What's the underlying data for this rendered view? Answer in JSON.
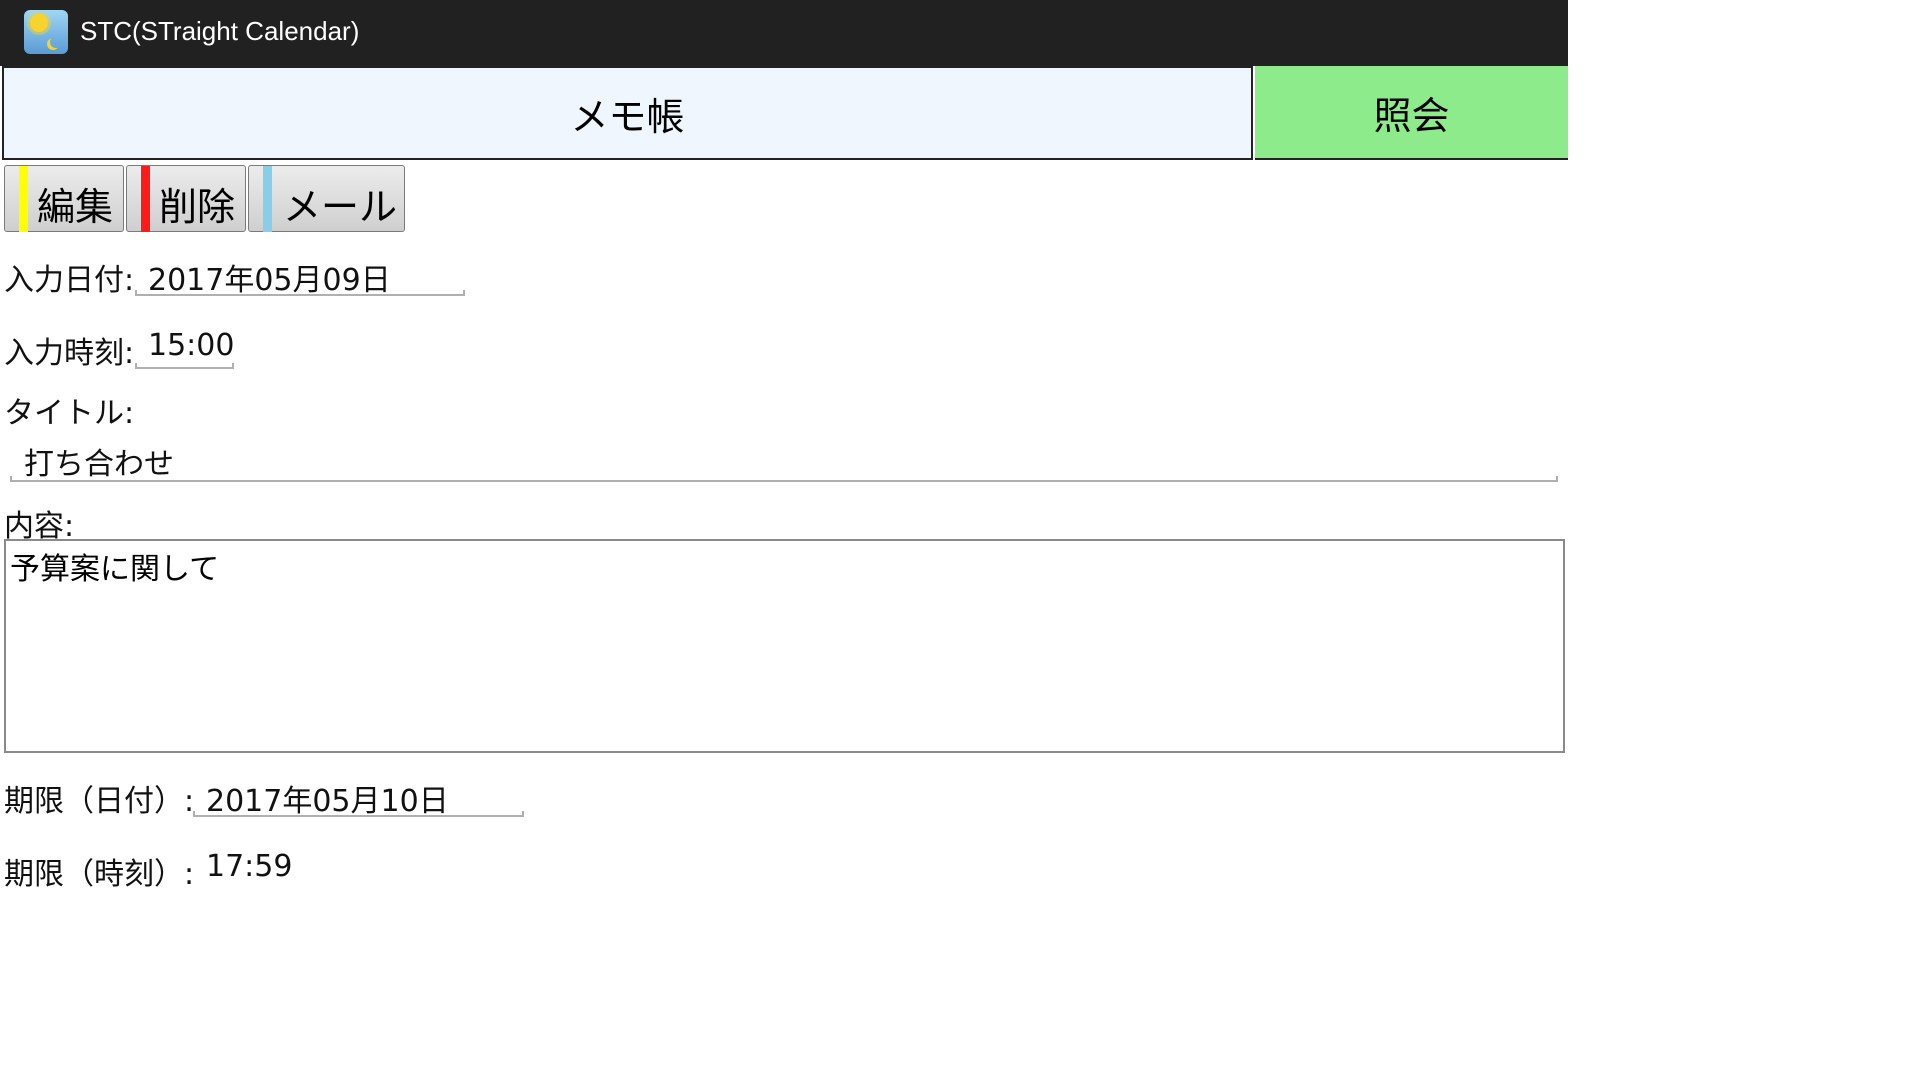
{
  "app": {
    "title": "STC(STraight Calendar)",
    "icon": "app-icon"
  },
  "header": {
    "memo_label": "メモ帳",
    "view_label": "照会",
    "colors": {
      "memo_bg": "#eff6fe",
      "view_bg": "#8eeb8c"
    }
  },
  "toolbar": {
    "edit_label": "編集",
    "delete_label": "削除",
    "mail_label": "メール",
    "stripe_colors": {
      "edit": "#ffff00",
      "delete": "#ff1a1a",
      "mail": "#87ceeb"
    }
  },
  "form": {
    "entry_date_label": "入力日付:",
    "entry_date_value": "2017年05月09日",
    "entry_time_label": "入力時刻:",
    "entry_time_value": "15:00",
    "title_label": "タイトル:",
    "title_value": "打ち合わせ",
    "content_label": "内容:",
    "content_value": "予算案に関して",
    "due_date_label": "期限（日付）:",
    "due_date_value": "2017年05月10日",
    "due_time_label": "期限（時刻）:",
    "due_time_value": "17:59"
  }
}
